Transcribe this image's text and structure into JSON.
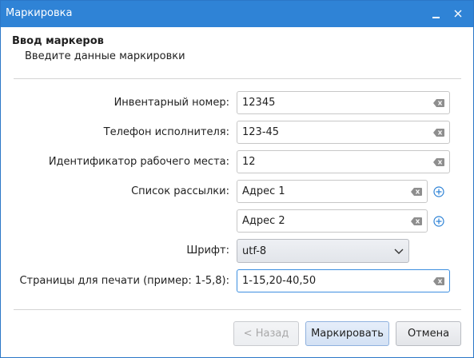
{
  "window": {
    "title": "Маркировка",
    "minimize_icon": "minimize-icon",
    "close_icon": "close-icon"
  },
  "header": {
    "title": "Ввод маркеров",
    "subtitle": "Введите данные маркировки"
  },
  "form": {
    "inventory": {
      "label": "Инвентарный номер:",
      "value": "12345"
    },
    "phone": {
      "label": "Телефон исполнителя:",
      "value": "123-45"
    },
    "workplace": {
      "label": "Идентификатор рабочего места:",
      "value": "12"
    },
    "mailing": {
      "label": "Список рассылки:",
      "items": [
        {
          "value": "Адрес 1"
        },
        {
          "value": "Адрес 2"
        }
      ]
    },
    "font": {
      "label": "Шрифт:",
      "value": "utf-8"
    },
    "pages": {
      "label": "Страницы для печати (пример: 1-5,8):",
      "value": "1-15,20-40,50"
    }
  },
  "buttons": {
    "back": "< Назад",
    "mark": "Маркировать",
    "cancel": "Отмена"
  },
  "colors": {
    "titlebar": "#2f83d6",
    "focus_border": "#3d8fe0",
    "plus_icon": "#2f83d6"
  }
}
